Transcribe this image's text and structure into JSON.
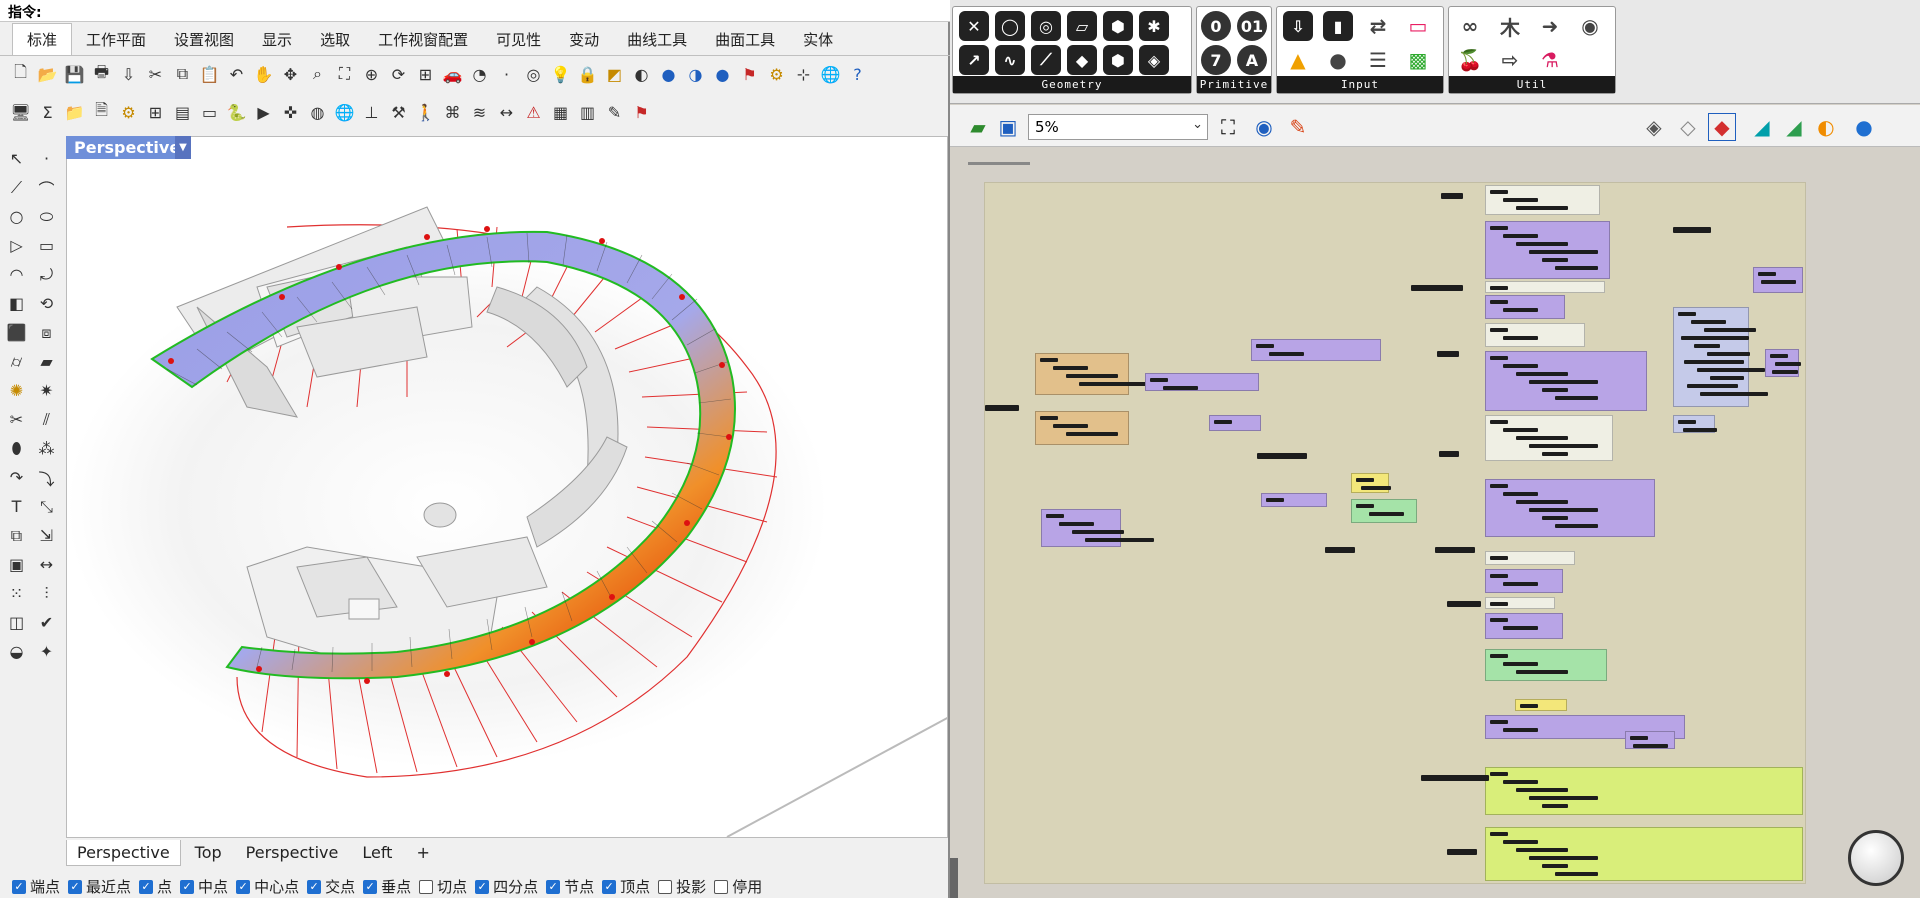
{
  "rhino": {
    "command_label": "指令:",
    "tabs": [
      {
        "label": "标准",
        "active": true
      },
      {
        "label": "工作平面"
      },
      {
        "label": "设置视图"
      },
      {
        "label": "显示"
      },
      {
        "label": "选取"
      },
      {
        "label": "工作视窗配置"
      },
      {
        "label": "可见性"
      },
      {
        "label": "变动"
      },
      {
        "label": "曲线工具"
      },
      {
        "label": "曲面工具"
      },
      {
        "label": "实体"
      }
    ],
    "toolbar1_icons": [
      "new-file-icon",
      "open-icon",
      "save-icon",
      "print-icon",
      "import-icon",
      "cut-icon",
      "copy-icon",
      "paste-icon",
      "undo-icon",
      "pan-icon",
      "move-icon",
      "zoom-window-icon",
      "zoom-extents-icon",
      "zoom-selected-icon",
      "rotate-view-icon",
      "four-viewports-icon",
      "car-icon",
      "camera-icon",
      "point-icon",
      "target-icon",
      "light-icon",
      "lock-icon",
      "material-icon",
      "color-wheel-icon",
      "sphere-render-icon",
      "sphere-shaded-icon",
      "sphere-blue-icon",
      "flag-icon",
      "gear-options-icon",
      "grid-icon",
      "globe-icon",
      "help-icon"
    ],
    "toolbar2_icons": [
      "monitor-icon",
      "measure-icon",
      "folder-icon",
      "document-icon",
      "gear-icon",
      "grid-snap-icon",
      "layout-icon",
      "panel-icon",
      "python-icon",
      "terminal-icon",
      "puzzle-icon",
      "lifebuoy-icon",
      "globe-icon",
      "tree-icon",
      "tools-icon",
      "walk-icon",
      "html-icon",
      "tune-icon",
      "dimension-icon",
      "warning-icon",
      "package-icon",
      "bag-icon",
      "brush-icon",
      "flag-red-icon"
    ],
    "left_tools": [
      "select-icon",
      "point-icon",
      "polyline-icon",
      "curve-edit-icon",
      "circle-icon",
      "ellipse-icon",
      "polygon-icon",
      "rectangle-icon",
      "arc-icon",
      "fillet-curve-icon",
      "surface-icon",
      "revolve-icon",
      "box-icon",
      "boolean-union-icon",
      "cylinder-icon",
      "plane-surface-icon",
      "gear-orange-icon",
      "explode-icon",
      "trim-icon",
      "split-icon",
      "paint-icon",
      "scatter-icon",
      "bend-icon",
      "twist-icon",
      "text-icon",
      "scale-icon",
      "group-icon",
      "move-copy-icon",
      "block-icon",
      "dimension-icon",
      "array-icon",
      "align-icon",
      "layer-icon",
      "check-icon",
      "shade-icon",
      "render-icon"
    ],
    "viewport_title": "Perspective",
    "viewport_tabs": [
      {
        "label": "Perspective",
        "active": true
      },
      {
        "label": "Top"
      },
      {
        "label": "Perspective"
      },
      {
        "label": "Left"
      },
      {
        "label": "+"
      }
    ],
    "osnaps": [
      {
        "label": "端点",
        "checked": true
      },
      {
        "label": "最近点",
        "checked": true
      },
      {
        "label": "点",
        "checked": true
      },
      {
        "label": "中点",
        "checked": true
      },
      {
        "label": "中心点",
        "checked": true
      },
      {
        "label": "交点",
        "checked": true
      },
      {
        "label": "垂点",
        "checked": true
      },
      {
        "label": "切点",
        "checked": false
      },
      {
        "label": "四分点",
        "checked": true
      },
      {
        "label": "节点",
        "checked": true
      },
      {
        "label": "顶点",
        "checked": true
      },
      {
        "label": "投影",
        "checked": false
      },
      {
        "label": "停用",
        "checked": false
      }
    ]
  },
  "grasshopper": {
    "ribbon_groups": [
      {
        "label": "Geometry"
      },
      {
        "label": "Primitive"
      },
      {
        "label": "Input"
      },
      {
        "label": "Util"
      }
    ],
    "geometry_icons": [
      "x-icon",
      "circle-icon",
      "ring-icon",
      "plane-icon",
      "box-icon",
      "mesh-icon",
      "vector-icon",
      "curve-icon",
      "segment-icon",
      "diamond-icon",
      "cube-icon",
      "brep-icon"
    ],
    "primitive_icons": [
      "circle-icon",
      "binary-icon",
      "number-icon",
      "text-icon"
    ],
    "primitive_glyphs": [
      "0",
      "01",
      "7",
      "A"
    ],
    "input_icons": [
      "import-icon",
      "slider-icon",
      "toggle-icon",
      "panel-icon",
      "graph-icon",
      "button-icon",
      "list-icon",
      "pixel-icon"
    ],
    "util_icons": [
      "glasses-icon",
      "tree-icon",
      "arrow-icon",
      "cluster-icon",
      "cherry-icon",
      "arrow-outline-icon",
      "flask-icon"
    ],
    "zoom_value": "5%",
    "toolbar_icons": [
      "open-icon",
      "save-icon",
      "zoom-extents-icon",
      "eye-icon",
      "pen-icon",
      "preview-wire-icon",
      "preview-shaded-icon",
      "preview-selected-icon",
      "paint-cyan-icon",
      "paint-green-icon",
      "split-color-icon",
      "sphere-blue-icon"
    ],
    "accent_purple": "#b8a4e6",
    "accent_orange": "#e2c08b",
    "accent_green": "#a5e3a8",
    "accent_lime": "#d9ee7a"
  }
}
